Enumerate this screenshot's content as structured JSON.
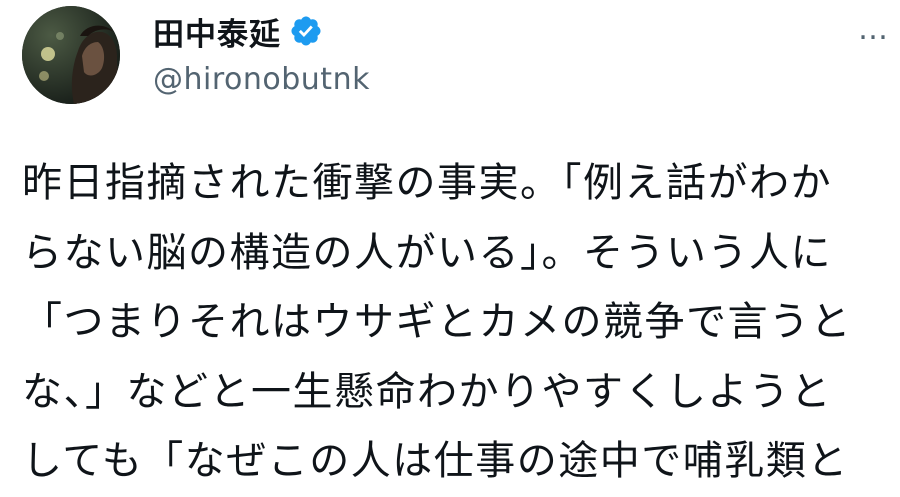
{
  "author": {
    "display_name": "田中泰延",
    "handle": "@hironobutnk",
    "verified_icon": "verified-check-icon",
    "avatar": "avatar-photo"
  },
  "menu": {
    "icon": "more-dots-icon",
    "label": "…"
  },
  "tweet": {
    "lines": [
      "昨日指摘された衝撃の事実。「例え話がわか",
      "らない脳の構造の人がいる」。そういう人に",
      "「つまりそれはウサギとカメの競争で言うと",
      "な、」などと一生懸命わかりやすくしようと",
      "しても「なぜこの人は仕事の途中で哺乳類と"
    ]
  },
  "colors": {
    "verified": "#1d9bf0",
    "handle": "#536471",
    "text": "#0f1419"
  }
}
